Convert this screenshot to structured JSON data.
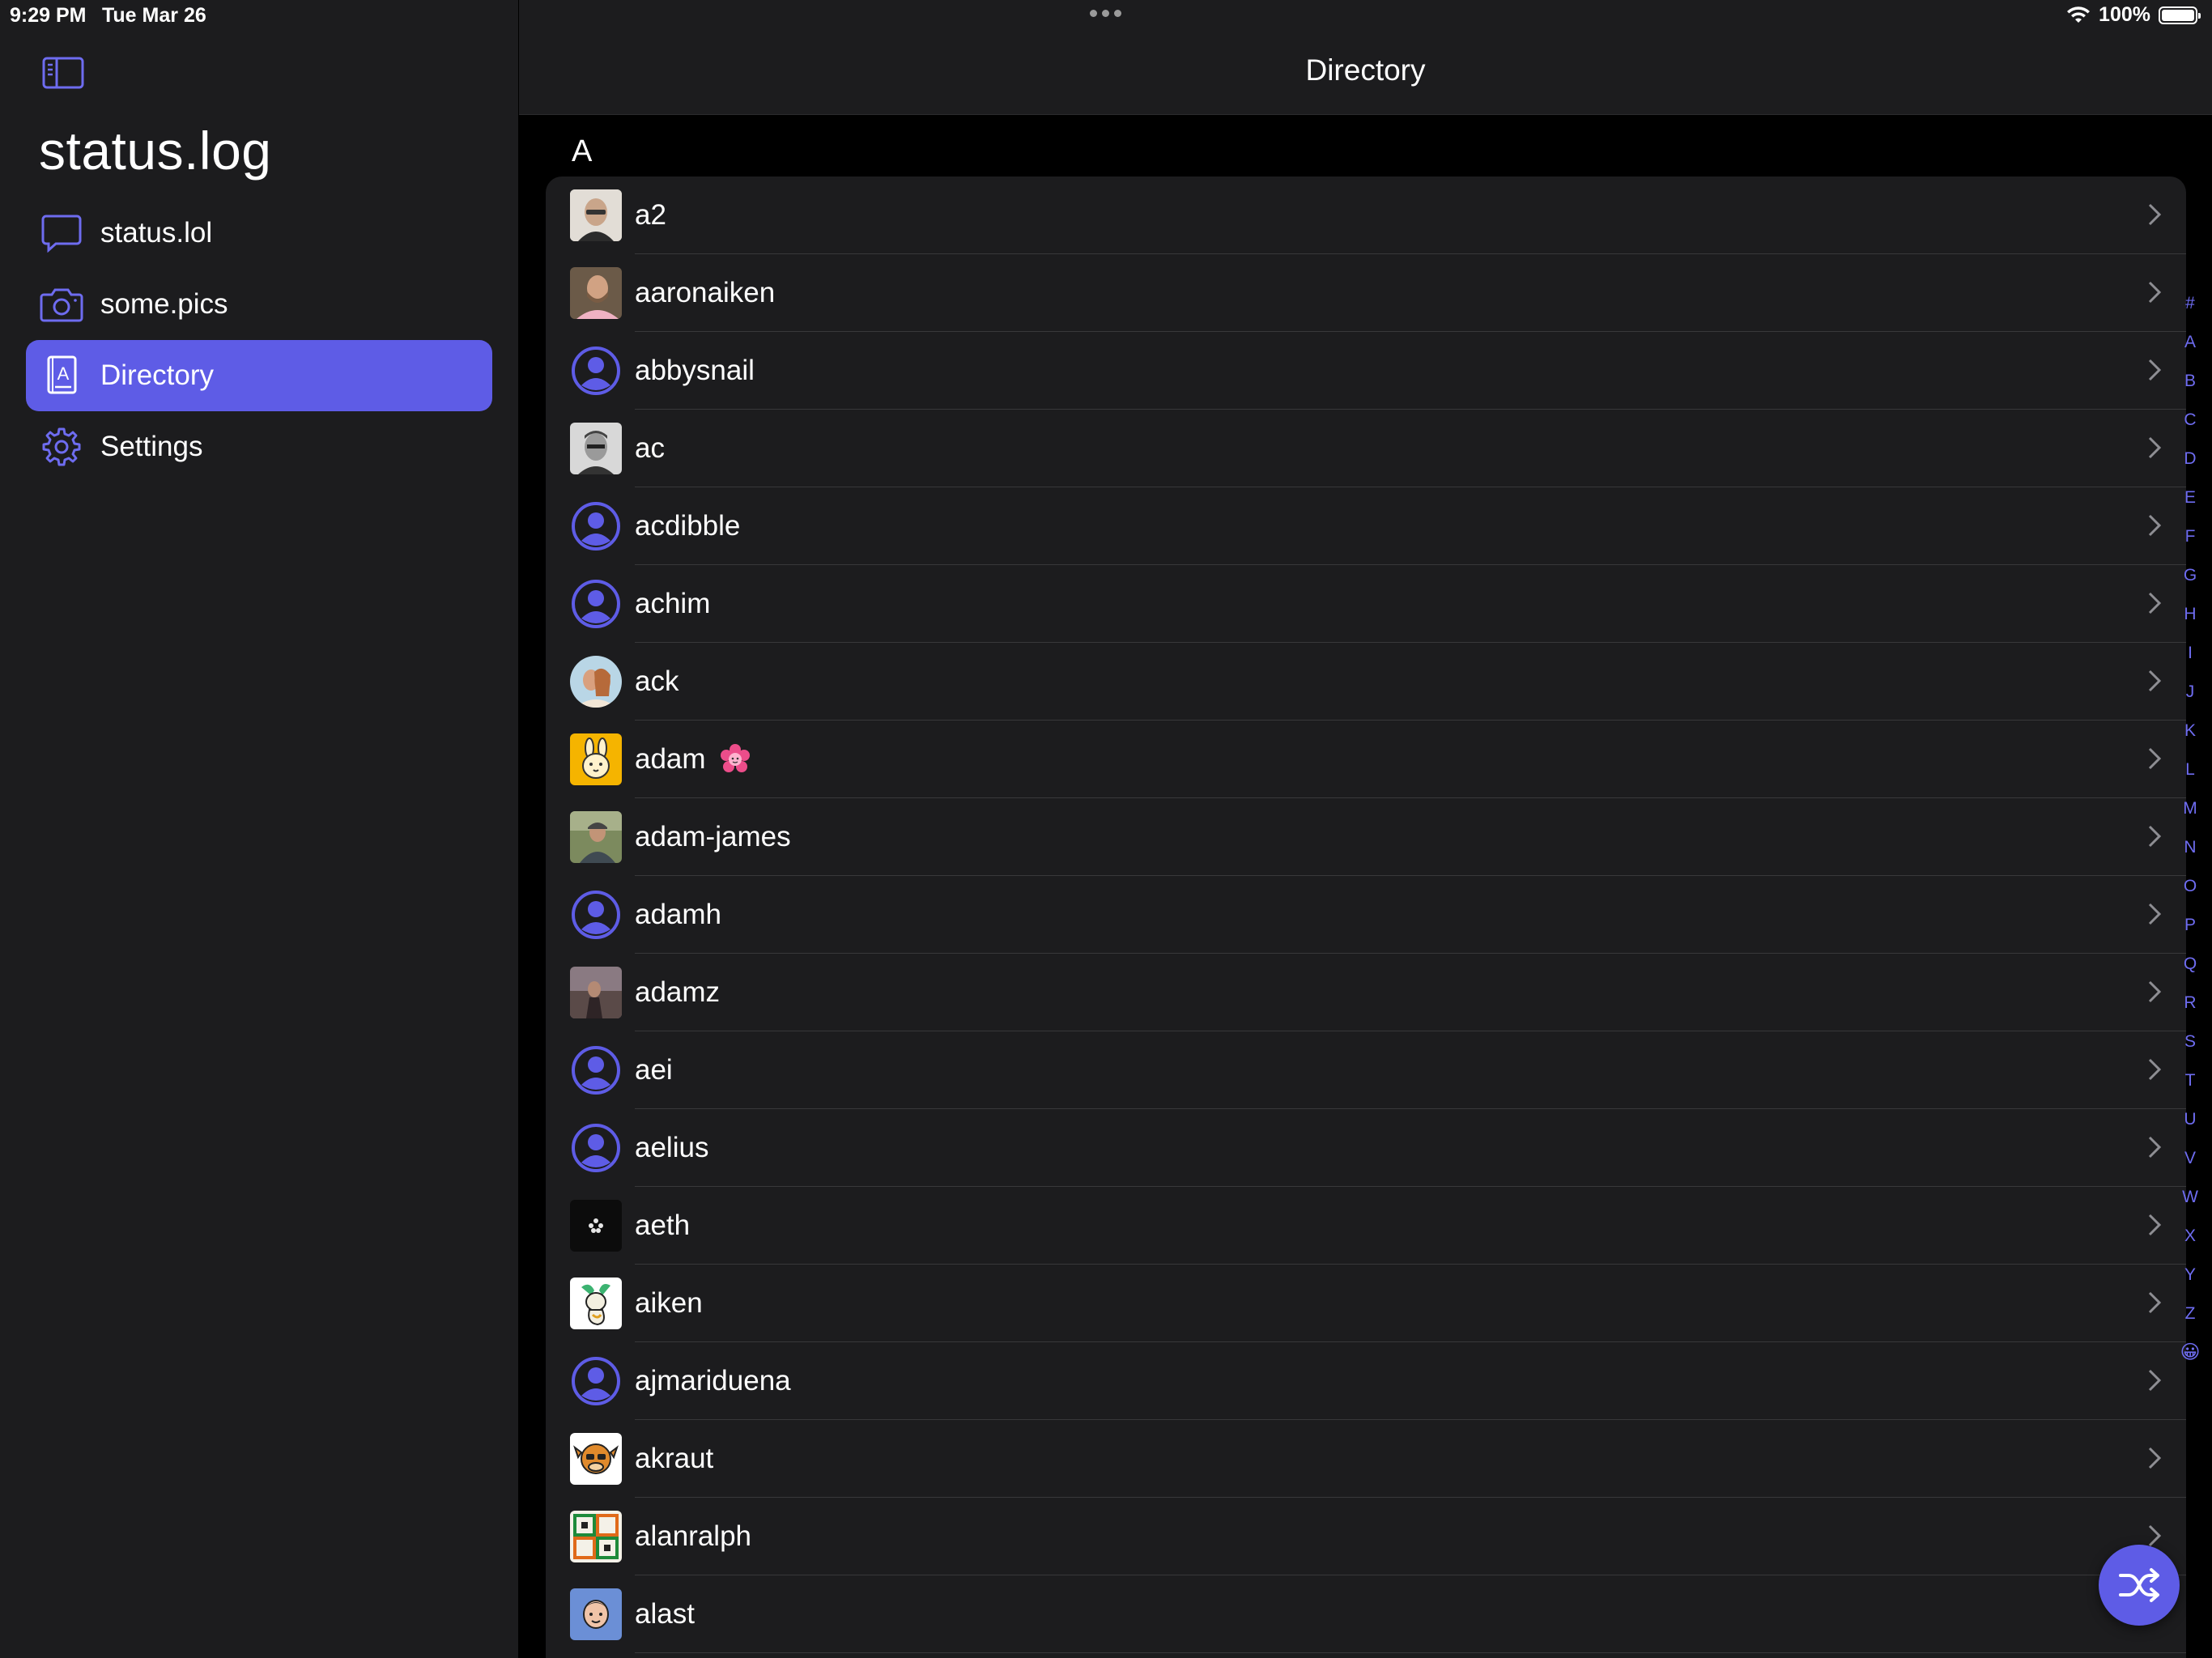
{
  "status_bar": {
    "time": "9:29 PM",
    "date": "Tue Mar 26",
    "battery": "100%"
  },
  "sidebar": {
    "title": "status.log",
    "items": [
      {
        "label": "status.lol",
        "icon": "speech-bubble-icon"
      },
      {
        "label": "some.pics",
        "icon": "camera-icon"
      },
      {
        "label": "Directory",
        "icon": "address-book-icon",
        "selected": true
      },
      {
        "label": "Settings",
        "icon": "gear-icon"
      }
    ]
  },
  "main": {
    "title": "Directory",
    "section": "A",
    "rows": [
      {
        "name": "a2",
        "avatar": "photo-bald-man"
      },
      {
        "name": "aaronaiken",
        "avatar": "photo-man-beard"
      },
      {
        "name": "abbysnail",
        "avatar": "placeholder"
      },
      {
        "name": "ac",
        "avatar": "photo-bw-man"
      },
      {
        "name": "acdibble",
        "avatar": "placeholder"
      },
      {
        "name": "achim",
        "avatar": "placeholder"
      },
      {
        "name": "ack",
        "avatar": "photo-round-couple"
      },
      {
        "name": "adam",
        "avatar": "bunny-yellow",
        "badge": "pink-flower-badge"
      },
      {
        "name": "adam-james",
        "avatar": "photo-cyclist"
      },
      {
        "name": "adamh",
        "avatar": "placeholder"
      },
      {
        "name": "adamz",
        "avatar": "photo-person-landscape"
      },
      {
        "name": "aei",
        "avatar": "placeholder"
      },
      {
        "name": "aelius",
        "avatar": "placeholder"
      },
      {
        "name": "aeth",
        "avatar": "dark-flower"
      },
      {
        "name": "aiken",
        "avatar": "cartoon-dragon"
      },
      {
        "name": "ajmariduena",
        "avatar": "placeholder"
      },
      {
        "name": "akraut",
        "avatar": "cartoon-monkey"
      },
      {
        "name": "alanralph",
        "avatar": "pixel-green-orange"
      },
      {
        "name": "alast",
        "avatar": "cartoon-face"
      }
    ]
  },
  "index_letters": [
    "#",
    "A",
    "B",
    "C",
    "D",
    "E",
    "F",
    "G",
    "H",
    "I",
    "J",
    "K",
    "L",
    "M",
    "N",
    "O",
    "P",
    "Q",
    "R",
    "S",
    "T",
    "U",
    "V",
    "W",
    "X",
    "Y",
    "Z",
    "😀"
  ],
  "colors": {
    "accent": "#5e5ce6",
    "sidebar_bg": "#1c1c1e",
    "background": "#000000"
  },
  "fab": {
    "icon": "shuffle-icon"
  }
}
